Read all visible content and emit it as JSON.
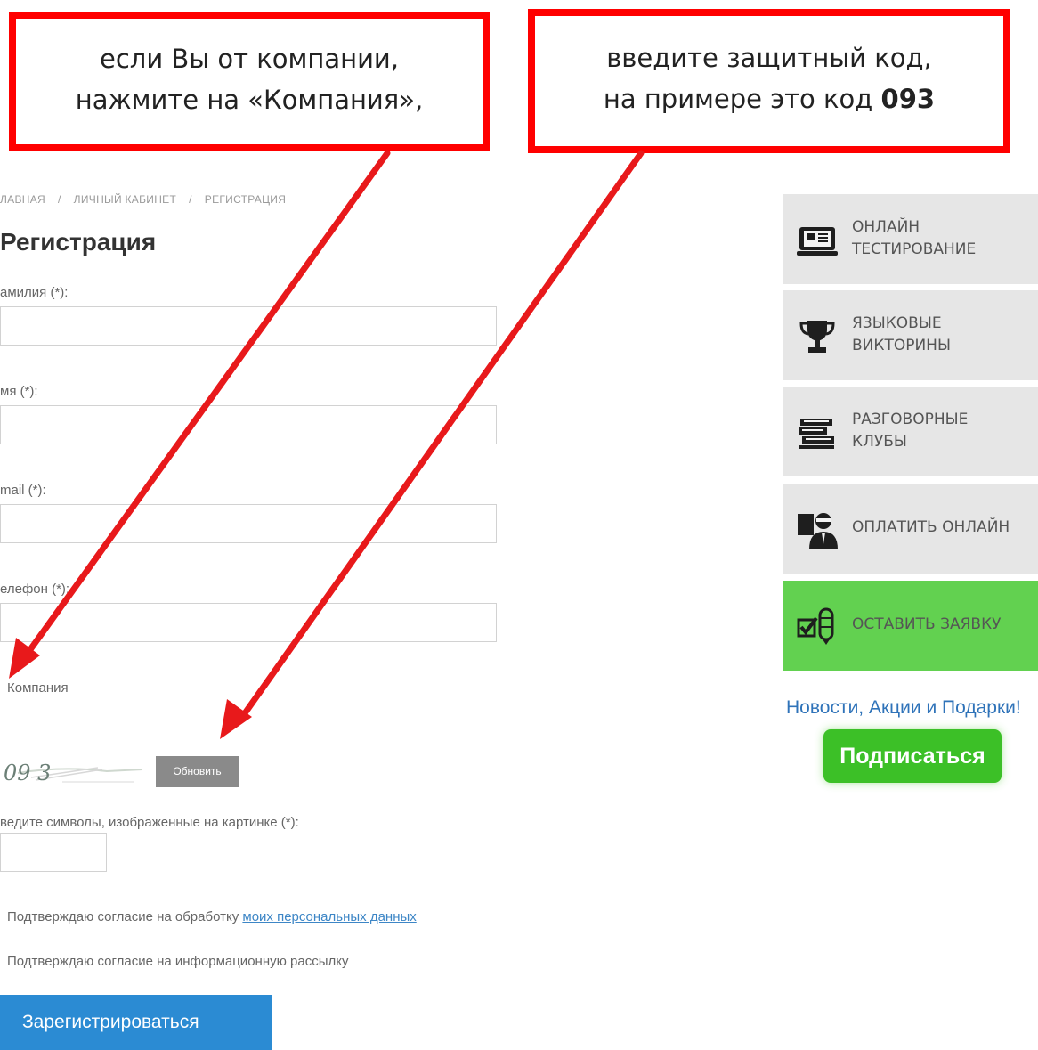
{
  "callouts": {
    "company": {
      "line1": "если Вы от компании,",
      "line2": "нажмите на «Компания»,"
    },
    "captcha": {
      "line1": "введите защитный код,",
      "line2_prefix": "на примере это код ",
      "line2_code": "093"
    }
  },
  "breadcrumb": {
    "home": "ЛАВНАЯ",
    "separator": "/",
    "cabinet": "ЛИЧНЫЙ КАБИНЕТ",
    "current": "РЕГИСТРАЦИЯ"
  },
  "page_title": "Регистрация",
  "form": {
    "surname_label": "амилия (*):",
    "name_label": "мя (*):",
    "email_label": "mail (*):",
    "phone_label": "елефон (*):",
    "company_label": "Компания",
    "captcha_image_text": "09 3",
    "refresh_label": "Обновить",
    "captcha_label": "ведите символы, изображенные на картинке (*):",
    "consent_personal_prefix": "Подтверждаю согласие на обработку ",
    "consent_personal_link": "моих персональных данных",
    "consent_newsletter": "Подтверждаю согласие на информационную рассылку",
    "register_label": "Зарегистрироваться"
  },
  "sidebar": {
    "items": [
      {
        "line1": "ОНЛАЙН",
        "line2": "ТЕСТИРОВАНИЕ",
        "icon": "monitor-icon"
      },
      {
        "line1": "ЯЗЫКОВЫЕ",
        "line2": "ВИКТОРИНЫ",
        "icon": "trophy-icon"
      },
      {
        "line1": "РАЗГОВОРНЫЕ",
        "line2": "КЛУБЫ",
        "icon": "books-icon"
      },
      {
        "line1": "ОПЛАТИТЬ ОНЛАЙН",
        "icon": "user-pay-icon"
      },
      {
        "line1": "ОСТАВИТЬ ЗАЯВКУ",
        "icon": "checklist-icon"
      }
    ],
    "news_text": "Новости, Акции и Подарки!",
    "subscribe_label": "Подписаться"
  },
  "colors": {
    "callout_border": "#ff0000",
    "arrow": "#e8191b",
    "register_button": "#2b8bd3",
    "order_item": "#62d150",
    "subscribe": "#3cc027",
    "link": "#3d86c6"
  }
}
